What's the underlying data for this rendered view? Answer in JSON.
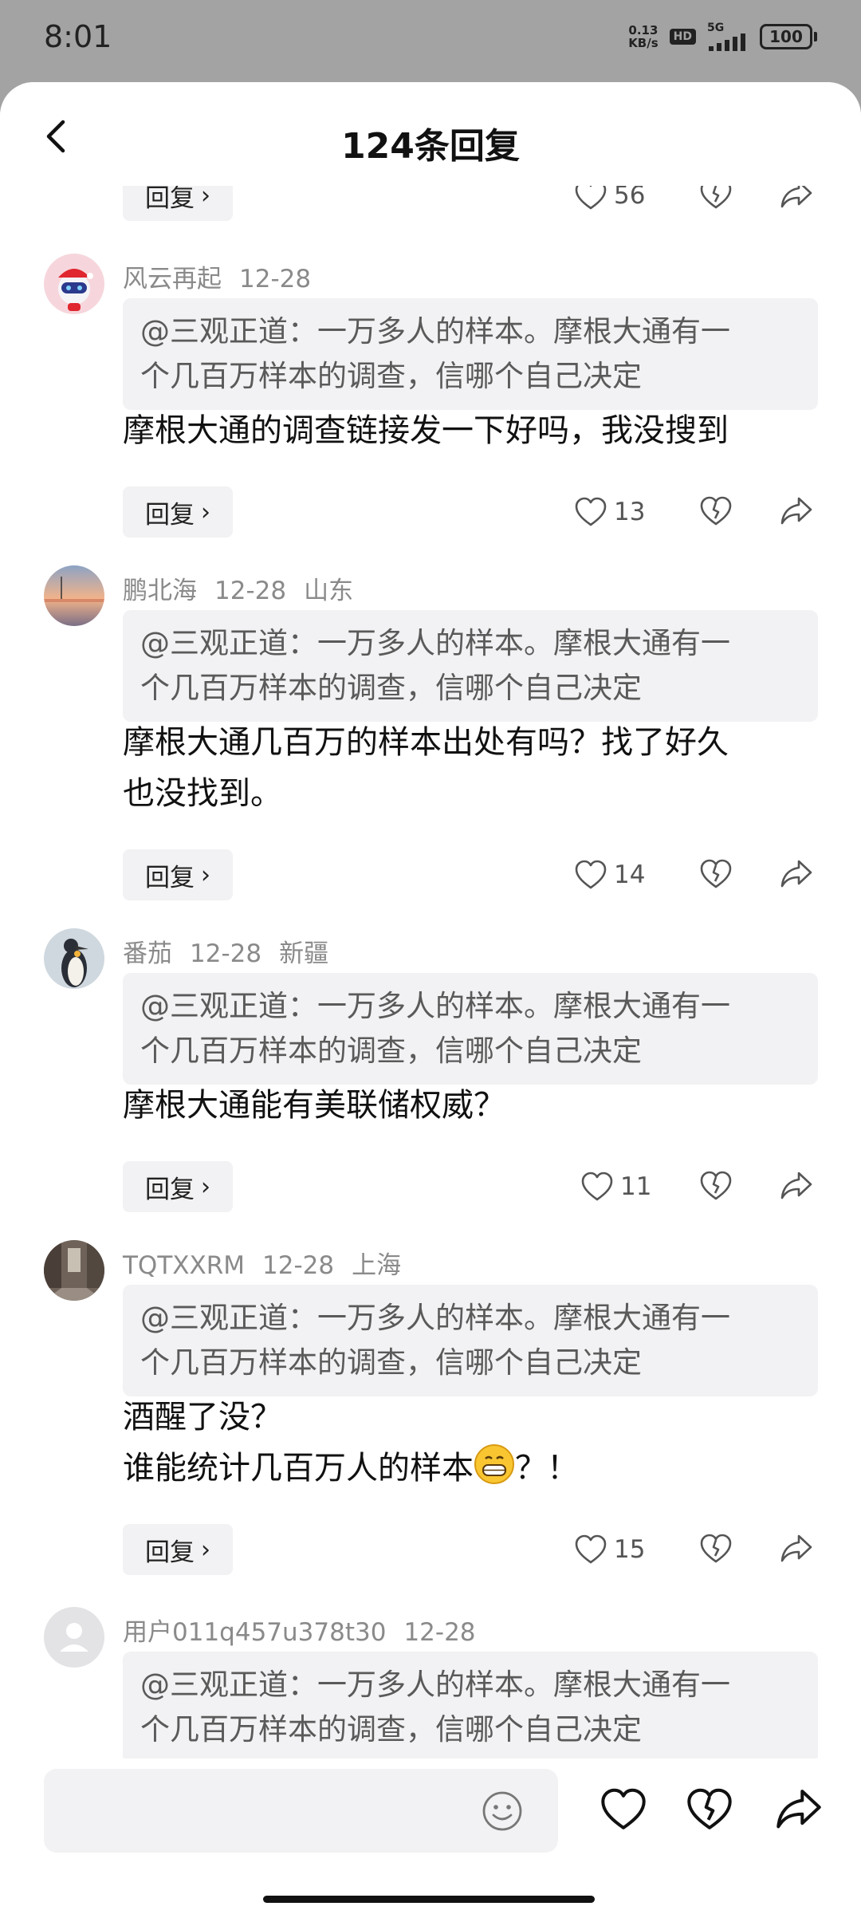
{
  "status": {
    "time": "8:01",
    "net_speed_value": "0.13",
    "net_speed_unit": "KB/s",
    "hd": "HD",
    "network": "5G",
    "battery": "100"
  },
  "header": {
    "title": "124条回复"
  },
  "partial_top": {
    "reply_label": "回复",
    "likes": "56"
  },
  "comments": [
    {
      "user": "风云再起",
      "date": "12-28",
      "location": "",
      "quote_lines": [
        "@三观正道：一万多人的样本。摩根大通有一",
        "个几百万样本的调查，信哪个自己决定"
      ],
      "text_lines": [
        "摩根大通的调查链接发一下好吗，我没搜到"
      ],
      "reply_label": "回复",
      "likes": "13"
    },
    {
      "user": "鹏北海",
      "date": "12-28",
      "location": "山东",
      "quote_lines": [
        "@三观正道：一万多人的样本。摩根大通有一",
        "个几百万样本的调查，信哪个自己决定"
      ],
      "text_lines": [
        "摩根大通几百万的样本出处有吗？找了好久",
        "也没找到。"
      ],
      "reply_label": "回复",
      "likes": "14"
    },
    {
      "user": "番茄",
      "date": "12-28",
      "location": "新疆",
      "quote_lines": [
        "@三观正道：一万多人的样本。摩根大通有一",
        "个几百万样本的调查，信哪个自己决定"
      ],
      "text_lines": [
        "摩根大通能有美联储权威？"
      ],
      "reply_label": "回复",
      "likes": "11"
    },
    {
      "user": "TQTXXRM",
      "date": "12-28",
      "location": "上海",
      "quote_lines": [
        "@三观正道：一万多人的样本。摩根大通有一",
        "个几百万样本的调查，信哪个自己决定"
      ],
      "text_lines": [
        "酒醒了没？",
        "谁能统计几百万人的样本"
      ],
      "text_suffix": "？！",
      "reply_label": "回复",
      "likes": "15"
    },
    {
      "user": "用户011q457u378t30",
      "date": "12-28",
      "location": "",
      "quote_lines": [
        "@三观正道：一万多人的样本。摩根大通有一",
        "个几百万样本的调查，信哪个自己决定"
      ]
    }
  ],
  "bottom_bar": {
    "input_placeholder": ""
  },
  "colors": {
    "background_dim": "#a3a3a3",
    "quote_bg": "#f2f2f4",
    "meta_text": "#8a8a8a"
  }
}
